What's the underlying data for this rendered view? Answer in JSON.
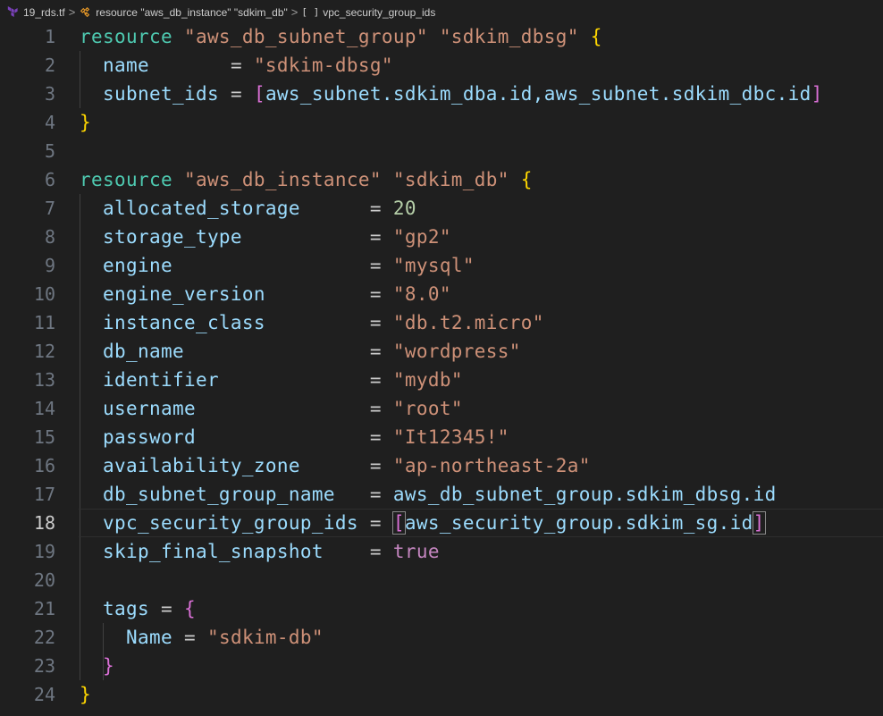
{
  "breadcrumb": {
    "file": "19_rds.tf",
    "resource": "resource \"aws_db_instance\" \"sdkim_db\"",
    "field_icon": "[ ]",
    "field": "vpc_security_group_ids",
    "separator": ">"
  },
  "editor": {
    "current_line": 18,
    "line_numbers": [
      "1",
      "2",
      "3",
      "4",
      "5",
      "6",
      "7",
      "8",
      "9",
      "10",
      "11",
      "12",
      "13",
      "14",
      "15",
      "16",
      "17",
      "18",
      "19",
      "20",
      "21",
      "22",
      "23",
      "24"
    ],
    "l1": [
      "resource",
      "\"aws_db_subnet_group\"",
      "\"sdkim_dbsg\"",
      "{"
    ],
    "l2": [
      "name",
      "=",
      "\"sdkim-dbsg\""
    ],
    "l3": [
      "subnet_ids",
      "=",
      "[",
      "aws_subnet.sdkim_dba.id,aws_subnet.sdkim_dbc.id",
      "]"
    ],
    "l4": [
      "}"
    ],
    "l6": [
      "resource",
      "\"aws_db_instance\"",
      "\"sdkim_db\"",
      "{"
    ],
    "l7": [
      "allocated_storage",
      "=",
      "20"
    ],
    "l8": [
      "storage_type",
      "=",
      "\"gp2\""
    ],
    "l9": [
      "engine",
      "=",
      "\"mysql\""
    ],
    "l10": [
      "engine_version",
      "=",
      "\"8.0\""
    ],
    "l11": [
      "instance_class",
      "=",
      "\"db.t2.micro\""
    ],
    "l12": [
      "db_name",
      "=",
      "\"wordpress\""
    ],
    "l13": [
      "identifier",
      "=",
      "\"mydb\""
    ],
    "l14": [
      "username",
      "=",
      "\"root\""
    ],
    "l15": [
      "password",
      "=",
      "\"It12345!\""
    ],
    "l16": [
      "availability_zone",
      "=",
      "\"ap-northeast-2a\""
    ],
    "l17": [
      "db_subnet_group_name",
      "=",
      "aws_db_subnet_group.sdkim_dbsg.id"
    ],
    "l18": [
      "vpc_security_group_ids",
      "=",
      "[",
      "aws_security_group.sdkim_sg.id",
      "]"
    ],
    "l19": [
      "skip_final_snapshot",
      "=",
      "true"
    ],
    "l21": [
      "tags",
      "=",
      "{"
    ],
    "l22": [
      "Name",
      "=",
      "\"sdkim-db\""
    ],
    "l23": [
      "}"
    ],
    "l24": [
      "}"
    ]
  },
  "colors": {
    "background": "#1f1f1f",
    "keyword": "#4ec9b0",
    "string": "#ce9178",
    "attribute": "#9cdcfe",
    "number": "#b5cea8",
    "boolean": "#c586c0",
    "bracket_level1": "#ffd700",
    "bracket_level2": "#da70d6",
    "line_number": "#6e7681"
  },
  "icons": {
    "file": "terraform-icon",
    "resource": "symbol-class-icon",
    "field": "symbol-array-icon"
  }
}
